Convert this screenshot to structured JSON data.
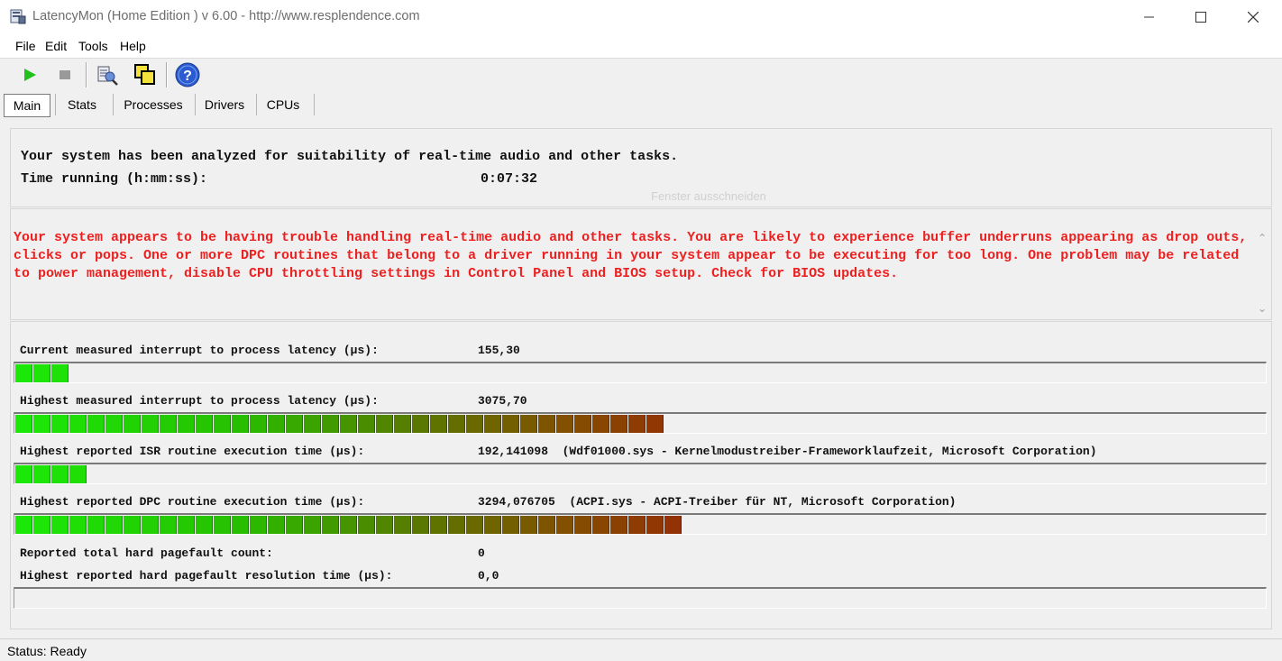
{
  "window": {
    "title": "LatencyMon  (Home Edition )  v 6.00 - http://www.resplendence.com"
  },
  "menu": [
    {
      "label": "File"
    },
    {
      "label": "Edit"
    },
    {
      "label": "Tools"
    },
    {
      "label": "Help"
    }
  ],
  "toolbar": {
    "icons": [
      "start-icon",
      "stop-icon",
      "report-icon",
      "copy-windows-icon",
      "help-icon"
    ]
  },
  "tabs": [
    {
      "label": "Main",
      "active": true
    },
    {
      "label": "Stats"
    },
    {
      "label": "Processes"
    },
    {
      "label": "Drivers"
    },
    {
      "label": "CPUs"
    }
  ],
  "summary": {
    "line1": "Your system has been analyzed for suitability of real-time audio and other tasks.",
    "time_label": "Time running (h:mm:ss):",
    "time_value": "0:07:32"
  },
  "ghost_text": "Fenster ausschneiden",
  "warning": "Your system appears to be having trouble handling real-time audio and other tasks. You are likely to experience buffer underruns appearing as drop outs, clicks or pops. One or more DPC routines that belong to a driver running in your system appear to be executing for too long. One problem may be related to power management, disable CPU throttling settings in Control Panel and BIOS setup. Check for BIOS updates.",
  "metrics": [
    {
      "label": "Current measured interrupt to process latency (µs):",
      "value": "155,30",
      "bar_segments": 3
    },
    {
      "label": "Highest measured interrupt to process latency (µs):",
      "value": "3075,70",
      "bar_segments": 36
    },
    {
      "label": "Highest reported ISR routine execution time (µs):",
      "value": "192,141098  (Wdf01000.sys - Kernelmodustreiber-Frameworklaufzeit, Microsoft Corporation)",
      "bar_segments": 4
    },
    {
      "label": "Highest reported DPC routine execution time (µs):",
      "value": "3294,076705  (ACPI.sys - ACPI-Treiber für NT, Microsoft Corporation)",
      "bar_segments": 37
    },
    {
      "label": "Reported total hard pagefault count:",
      "value": "0"
    },
    {
      "label": "Highest reported hard pagefault resolution time (µs):",
      "value": "0,0",
      "bar_segments": 0
    }
  ],
  "status": "Status: Ready"
}
